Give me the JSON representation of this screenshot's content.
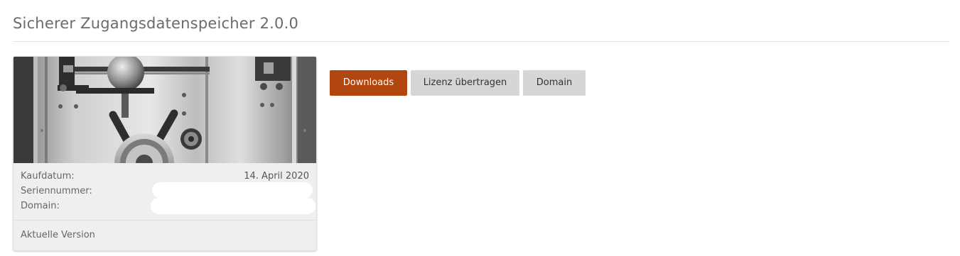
{
  "page": {
    "title": "Sicherer Zugangsdatenspeicher 2.0.0"
  },
  "product_card": {
    "image_icon": "vault-door-image",
    "purchase_date_label": "Kaufdatum:",
    "purchase_date_value": "14. April 2020",
    "serial_label": "Seriennummer:",
    "domain_label": "Domain:",
    "footer_label": "Aktuelle Version"
  },
  "actions": {
    "downloads_label": "Downloads",
    "transfer_license_label": "Lizenz übertragen",
    "domain_label": "Domain"
  },
  "colors": {
    "primary_button": "#b2460f",
    "secondary_button": "#d6d6d6",
    "card_background": "#efefef"
  }
}
